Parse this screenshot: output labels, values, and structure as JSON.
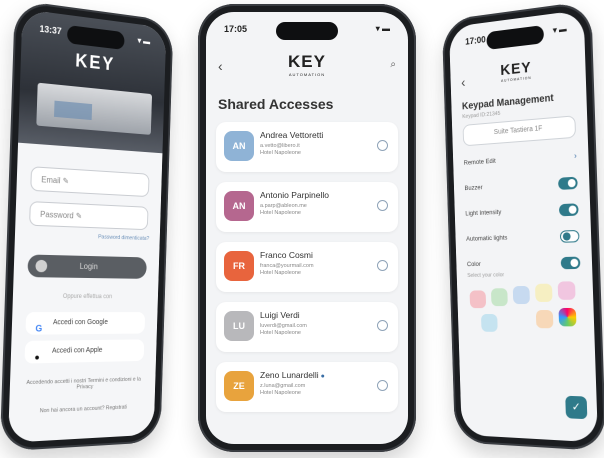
{
  "left_phone": {
    "time": "13:37",
    "status_icons": "▾ ▬",
    "logo": "KEY",
    "email_placeholder": "Email ✎",
    "password_placeholder": "Password ✎",
    "forgot_password": "Password dimenticata?",
    "login_label": "Login",
    "divider_text": "Oppure effettua con",
    "google_label": "Accedi con Google",
    "apple_label": "Accedi con Apple",
    "terms_text": "Accedendo accetti i nostri Termini e condizioni e la Privacy",
    "signup_text": "Non hai ancora un account? Registrati"
  },
  "mid_phone": {
    "time": "17:05",
    "status_icons": "▾ ▬",
    "logo": "KEY",
    "logo_sub": "AUTOMATION",
    "title": "Shared Accesses",
    "users": [
      {
        "initials": "AN",
        "name": "Andrea Vettoretti",
        "email": "a.vetto@libero.it",
        "hotel": "Hotel Napoleone",
        "color": "#8fb3d6",
        "owner": false
      },
      {
        "initials": "AN",
        "name": "Antonio Parpinello",
        "email": "a.parp@ableon.me",
        "hotel": "Hotel Napoleone",
        "color": "#b5678f",
        "owner": false
      },
      {
        "initials": "FR",
        "name": "Franco Cosmi",
        "email": "franca@yourmail.com",
        "hotel": "Hotel Napoleone",
        "color": "#e8643d",
        "owner": false
      },
      {
        "initials": "LU",
        "name": "Luigi Verdi",
        "email": "luverdi@gmail.com",
        "hotel": "Hotel Napoleone",
        "color": "#b8b8bb",
        "owner": false
      },
      {
        "initials": "ZE",
        "name": "Zeno Lunardelli",
        "email": "z.luna@gmail.com",
        "hotel": "Hotel Napoleone",
        "color": "#e8a33d",
        "owner": true
      }
    ]
  },
  "right_phone": {
    "time": "17:00",
    "status_icons": "▾ ▬",
    "logo": "KEY",
    "logo_sub": "AUTOMATION",
    "title": "Keypad Management",
    "subtitle": "Keypad ID:21345",
    "field_value": "Suite Tastiera 1F",
    "rows": [
      {
        "label": "Remote Edit",
        "control": "chevron"
      },
      {
        "label": "Buzzer",
        "control": "on"
      },
      {
        "label": "Light Intensity",
        "control": "on"
      },
      {
        "label": "Automatic lights",
        "control": "off"
      },
      {
        "label": "Color",
        "control": "on"
      }
    ],
    "color_hint": "Select your color",
    "swatches": [
      "#f4c1c7",
      "#c8e6c9",
      "#c7daf0",
      "#f6efc2",
      "#f1c6e0",
      "#c5e3f0",
      "#f7d8b8",
      "#b3e0c9"
    ]
  }
}
